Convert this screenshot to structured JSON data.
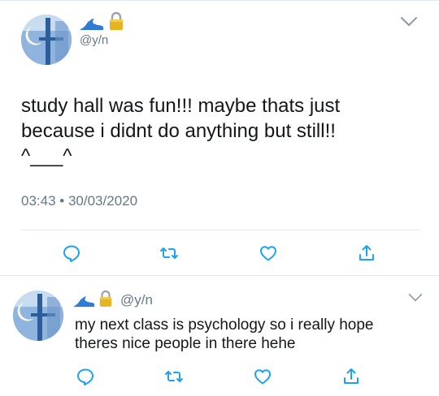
{
  "main_tweet": {
    "handle": "@y/n",
    "text": "study hall was fun!!! maybe thats just\nbecause i didnt do anything but still!!\n^___^",
    "time": "03:43",
    "separator": "•",
    "date": "30/03/2020",
    "emoji": [
      "water-wave-icon",
      "lock-icon"
    ]
  },
  "reply_tweet": {
    "handle": "@y/n",
    "text": "my next class is psychology so i really hope\ntheres nice people in there hehe",
    "emoji": [
      "water-wave-icon",
      "lock-icon"
    ]
  },
  "actions": [
    "reply-icon",
    "retweet-icon",
    "like-icon",
    "share-icon"
  ],
  "colors": {
    "text": "#14171a",
    "muted": "#657786",
    "divider": "#e1e8ed",
    "icon": "#1da1f2"
  }
}
